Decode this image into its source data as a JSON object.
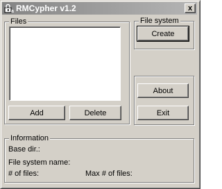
{
  "window": {
    "title": "RMCypher v1.2",
    "close_label": "x"
  },
  "files_group": {
    "label": "Files",
    "items": [],
    "add_label": "Add",
    "delete_label": "Delete"
  },
  "filesystem_group": {
    "label": "File system",
    "create_label": "Create"
  },
  "misc_group": {
    "about_label": "About",
    "exit_label": "Exit"
  },
  "information_group": {
    "label": "Information",
    "base_dir_label": "Base dir.:",
    "fs_name_label": "File system name:",
    "num_files_label": "# of files:",
    "max_files_label": "Max # of files:"
  }
}
